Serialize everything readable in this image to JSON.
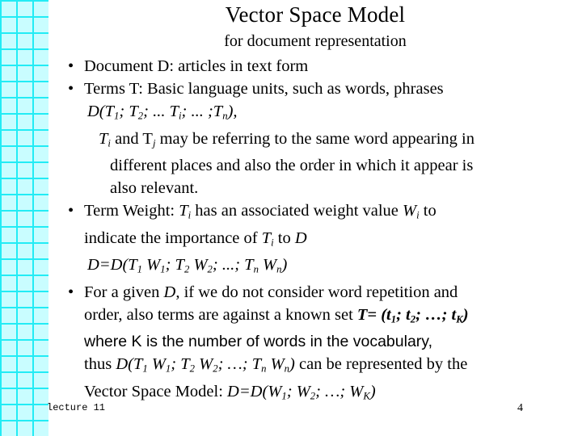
{
  "slide": {
    "title": "Vector Space Model",
    "subtitle": "for document representation",
    "bullet_glyph": "•",
    "accent_color": "#00e5ee",
    "background_color": "#ffffff",
    "text_color": "#000000"
  },
  "content": {
    "b1": "Document D:  articles in text form",
    "b2": "Terms T: Basic language units, such as words, phrases",
    "eq1_pre": "D(T",
    "eq1": {
      "d_open": "D(T",
      "s1": "1",
      "sep1": "; T",
      "s2": "2",
      "sep2": "; ... T",
      "si": "i",
      "sep3": "; ... ;T",
      "sn": "n",
      "close": "),"
    },
    "l3a_t": "T",
    "l3a_i": "i",
    "l3a_mid": " and T",
    "l3a_j": "j",
    "l3a_rest": " may be referring to the same word appearing in",
    "l3b": "different places and also the order in which it appear is",
    "l3c": "also relevant.",
    "b3_pre": "Term Weight: ",
    "b3_t": "T",
    "b3_ti": "i",
    "b3_mid": " has an associated weight value ",
    "b3_w": "W",
    "b3_wi": "i",
    "b3_end": " to",
    "b3_line2_pre": "indicate the importance of ",
    "b3_line2_t": "T",
    "b3_line2_ti": "i",
    "b3_line2_mid": " to ",
    "b3_line2_d": "D",
    "eq2": {
      "open": "D=D(T",
      "s1": "1",
      "w1": " W",
      "s1b": "1",
      "sep1": "; T",
      "s2": "2",
      "w2": " W",
      "s2b": "2",
      "sep2": "; ...; T",
      "sn": "n",
      "wn": " W",
      "snb": "n",
      "close": ")"
    },
    "b4_pre": "For a given ",
    "b4_d": "D",
    "b4_post": ", if we do not consider word repetition and",
    "b4_l2_pre": "order, also terms are against a known set ",
    "b4_l2_t": "T= (t",
    "b4_l2_s1": "1",
    "b4_l2_sep1": "; t",
    "b4_l2_s2": "2",
    "b4_l2_sep2": "; …; t",
    "b4_l2_sK": "K",
    "b4_l2_close": ")",
    "b4_l3": "where K is the number of words in the vocabulary,",
    "b4_l4_pre": "thus ",
    "b4_l4_eq": {
      "open": "D(T",
      "s1": "1",
      "w1": " W",
      "s1b": "1",
      "sep1": "; T",
      "s2": "2",
      "w2": " W",
      "s2b": "2",
      "sep2": "; …; T",
      "sn": "n",
      "wn": " W",
      "snb": "n",
      "close": ")"
    },
    "b4_l4_post": " can be represented by the",
    "b4_l5_pre": "Vector Space Model: ",
    "b4_l5_eq": {
      "open": "D=D(W",
      "s1": "1",
      "sep1": "; W",
      "s2": "2",
      "sep2": "; …; W",
      "sK": "K",
      "close": ")"
    }
  },
  "footer": {
    "left": "lecture 11",
    "page_number": "4"
  }
}
